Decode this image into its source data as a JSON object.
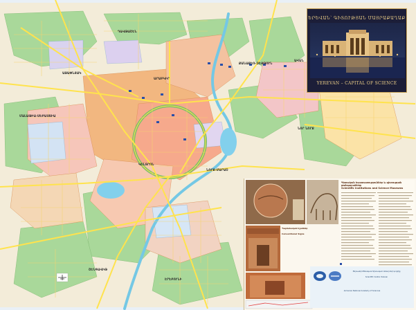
{
  "hero": {
    "title": "ԵՐԵՎԱՆ՝ ԳԻՏՈՒԹՅԱՆ ՄԱՅՐԱՔԱՂԱՔ",
    "subtitle": "YEREVAN – CAPITAL OF SCIENCE"
  },
  "district_labels": [
    {
      "id": "davitashen",
      "text": "ԴԱՎԹԱՇԵՆ"
    },
    {
      "id": "ajapnyak",
      "text": "ԱՋԱՓՆՅԱԿ"
    },
    {
      "id": "kanaker",
      "text": "ՔԱՆԱՔԵՌ-ԶԵՅԹՈՒՆ"
    },
    {
      "id": "avan",
      "text": "ԱՎԱՆ"
    },
    {
      "id": "nor-nork",
      "text": "ՆՈՐ ՆՈՐՔ"
    },
    {
      "id": "malatia",
      "text": "ՄԱԼԱԹԻԱ-ՍԵԲԱՍՏԻԱ"
    },
    {
      "id": "kentron",
      "text": "ԿԵՆՏՐՈՆ"
    },
    {
      "id": "nork-marash",
      "text": "ՆՈՐՔ-ՄԱՐԱՇ"
    },
    {
      "id": "erebuni",
      "text": "ԷՐԵԲՈՒՆԻ"
    },
    {
      "id": "shengavit",
      "text": "ՇԵՆԳԱՎԻԹ"
    },
    {
      "id": "arabkir",
      "text": "ԱՐԱԲԿԻՐ"
    }
  ],
  "panel": {
    "heading_arm": "Գիտական հաստատություններ և գիտության թանգարաններ",
    "heading_en": "Scientific Institutions and Science Museums",
    "legend_title_arm": "Պայմանական նշաններ",
    "legend_title_en": "Conventional Signs"
  },
  "footer": {
    "line1": "Յերևանի Թեմական Գիտական Կենտրոնի կողմից",
    "line2": "Scientific Centre Yerevan",
    "line3": "Armenian National Academy of Sciences"
  },
  "colors": {
    "green": "#9fd68e",
    "orange": "#f2ad6f",
    "pink": "#f3c6c8",
    "blue": "#8ad3ea",
    "yellow": "#f7e58e",
    "road": "#ffe34d"
  }
}
